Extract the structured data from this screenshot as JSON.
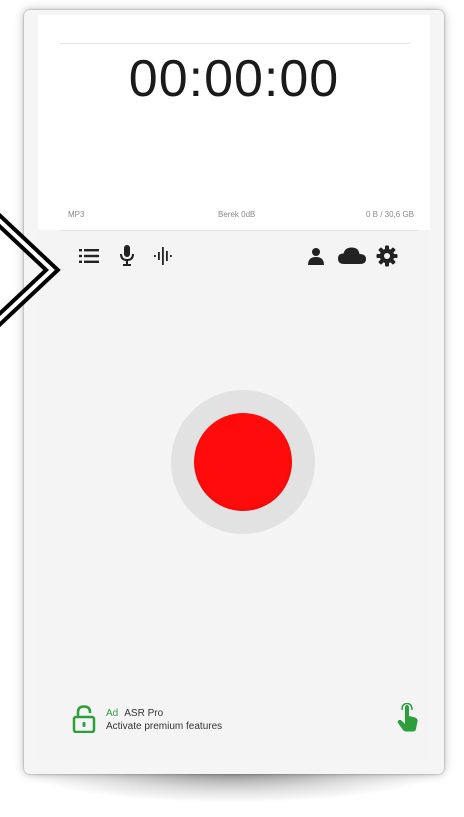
{
  "timer": {
    "display": "00:00:00"
  },
  "status": {
    "format": "MP3",
    "gain": "Berek 0dB",
    "storage": "0 B / 30,6 GB"
  },
  "toolbar": {
    "left_icons": [
      "list-icon",
      "microphone-icon",
      "waveform-icon"
    ],
    "right_icons": [
      "person-icon",
      "cloud-icon",
      "gear-icon"
    ]
  },
  "record": {
    "ring_color": "#e2e2e2",
    "button_color": "#ff0b0b"
  },
  "ad": {
    "tag": "Ad",
    "title": "ASR Pro",
    "subtitle": "Activate premium features",
    "accent_color": "#2e9e3a",
    "icons": [
      "unlock-icon",
      "tap-finger-icon"
    ]
  }
}
